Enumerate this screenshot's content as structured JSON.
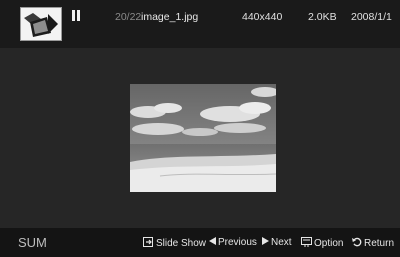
{
  "header": {
    "counter": "20/22",
    "filename": "image_1.jpg",
    "resolution": "440x440",
    "filesize": "2.0KB",
    "date": "2008/1/1",
    "status_icon": "pause-icon",
    "thumbnail_icon": "photo-folder-icon"
  },
  "footer": {
    "label": "SUM",
    "controls": [
      {
        "icon": "slideshow-icon",
        "label": "Slide Show"
      },
      {
        "icon": "previous-arrow-icon",
        "label": "Previous"
      },
      {
        "icon": "next-arrow-icon",
        "label": "Next"
      },
      {
        "icon": "option-icon",
        "label": "Option"
      },
      {
        "icon": "return-icon",
        "label": "Return"
      }
    ]
  },
  "colors": {
    "background": "#262626",
    "topbar": "#1a1a1a",
    "bottombar": "#141414",
    "counter": "#8a8a8a"
  }
}
